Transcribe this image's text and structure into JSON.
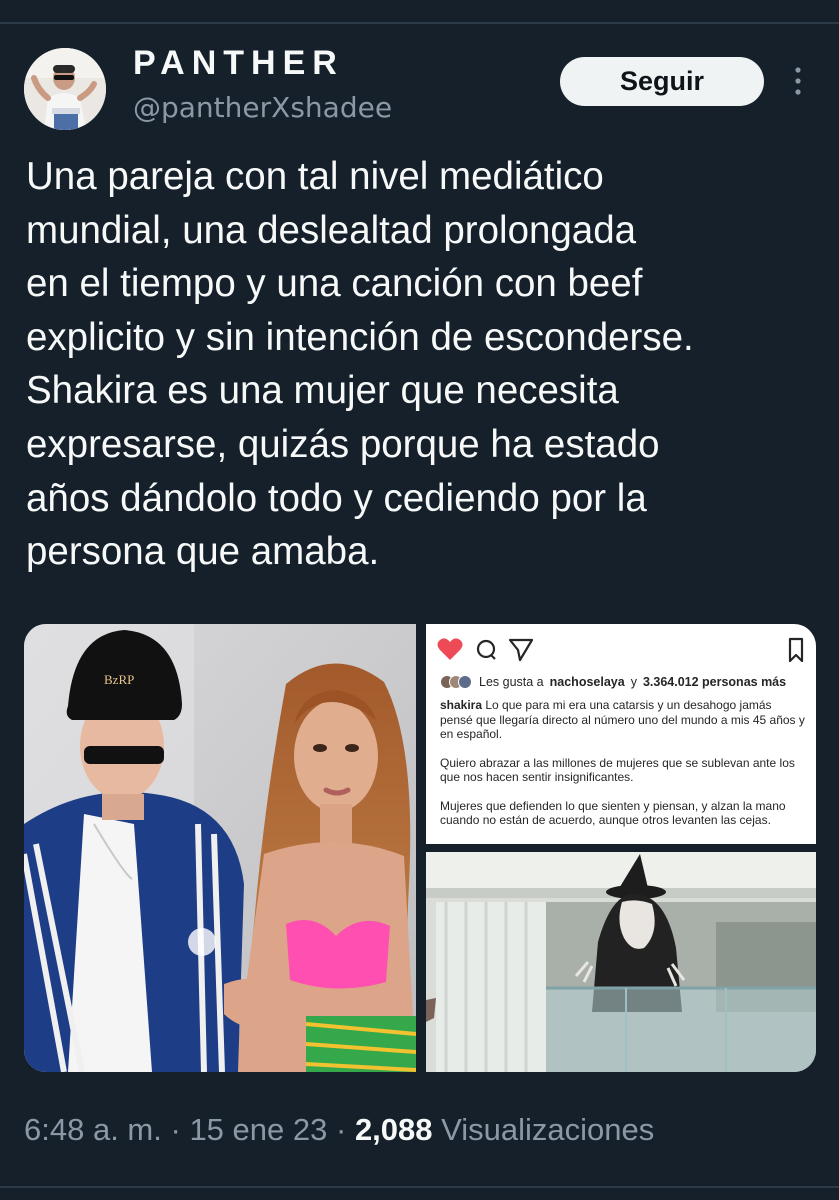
{
  "tweet": {
    "display_name": "PANTHER",
    "handle": "@pantherXshadee",
    "follow_label": "Seguir",
    "more_icon": "more-vertical-icon",
    "text_lines": [
      "Una pareja con tal nivel mediático",
      "mundial, una deslealtad prolongada",
      "en el tiempo y una canción con beef",
      "explicito y sin intención de esconderse.",
      "Shakira es una mujer que necesita",
      "expresarse, quizás porque ha estado",
      "años dándolo todo y cediendo por la",
      "persona que amaba."
    ],
    "media": {
      "photo_left": {
        "cap_text": "BzRP"
      },
      "instagram_post": {
        "likes_prefix": "Les gusta a",
        "likes_user": "nachoselaya",
        "likes_mid": "y",
        "likes_count": "3.364.012 personas más",
        "caption_user": "shakira",
        "caption_paragraphs": [
          "Lo que para mi era una catarsis y un desahogo jamás pensé que llegaría directo al número uno del mundo a mis 45 años y en español.",
          "Quiero abrazar a las millones de mujeres que se sublevan ante los que nos hacen sentir insignificantes.",
          "Mujeres que defienden lo que sienten y piensan, y alzan la mano cuando no están de acuerdo, aunque otros levanten las cejas."
        ]
      }
    },
    "footer": {
      "time": "6:48 a. m.",
      "sep1": "·",
      "date": "15 ene 23",
      "sep2": "·",
      "views_count": "2,088",
      "views_label": "Visualizaciones"
    }
  },
  "colors": {
    "background": "#15202b",
    "text": "#f7f9f9",
    "muted": "#8b98a5",
    "follow_bg": "#eff3f4",
    "instagram_heart": "#ed4956"
  }
}
